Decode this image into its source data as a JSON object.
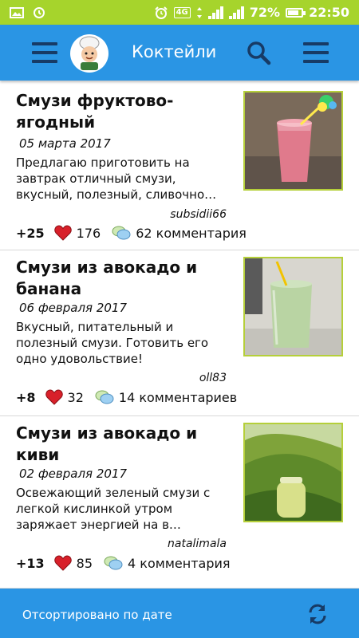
{
  "status_bar": {
    "battery_percent": "72%",
    "time": "22:50",
    "network_badge": "4G",
    "icons": [
      "image-icon",
      "sync-icon",
      "alarm-icon",
      "network-4g-icon",
      "data-transfer-icon",
      "signal-icon",
      "battery-icon"
    ]
  },
  "app_bar": {
    "title": "Коктейли",
    "left_menu_icon": "hamburger-icon",
    "logo_icon": "chef-logo-icon",
    "search_icon": "search-icon",
    "right_menu_icon": "hamburger-icon"
  },
  "articles": [
    {
      "title": "Смузи фруктово-ягодный",
      "date": "05 марта 2017",
      "description": "Предлагаю приготовить на завтрак отличный смузи, вкусный, полезный, сливочно…",
      "author": "subsidii66",
      "score": "+25",
      "likes": "176",
      "comments": "62 комментария",
      "thumb_colors": {
        "drink": "#e07a8c",
        "background": "#7a6a5a"
      }
    },
    {
      "title": "Смузи из авокадо и банана",
      "date": "06 февраля 2017",
      "description": "Вкусный, питательный и полезный смузи. Готовить его одно удовольствие!",
      "author": "oll83",
      "score": "+8",
      "likes": "32",
      "comments": "14 комментариев",
      "thumb_colors": {
        "drink": "#b9d4a3",
        "background": "#d8d6cf"
      }
    },
    {
      "title": "Смузи из авокадо и киви",
      "date": "02 февраля 2017",
      "description": "Освежающий зеленый смузи с легкой кислинкой утром заряжает энергией на в…",
      "author": "natalimala",
      "score": "+13",
      "likes": "85",
      "comments": "4 комментария",
      "thumb_colors": {
        "drink": "#d8e08a",
        "background": "#7fa33a"
      }
    }
  ],
  "bottom_bar": {
    "sort_label": "Отсортировано по дате",
    "refresh_icon": "refresh-icon"
  },
  "colors": {
    "status_bar": "#a6d42c",
    "primary": "#2a95e4",
    "menu_icon": "#173b66",
    "heart": "#d8202a",
    "thumb_border": "#b5cf3a"
  }
}
